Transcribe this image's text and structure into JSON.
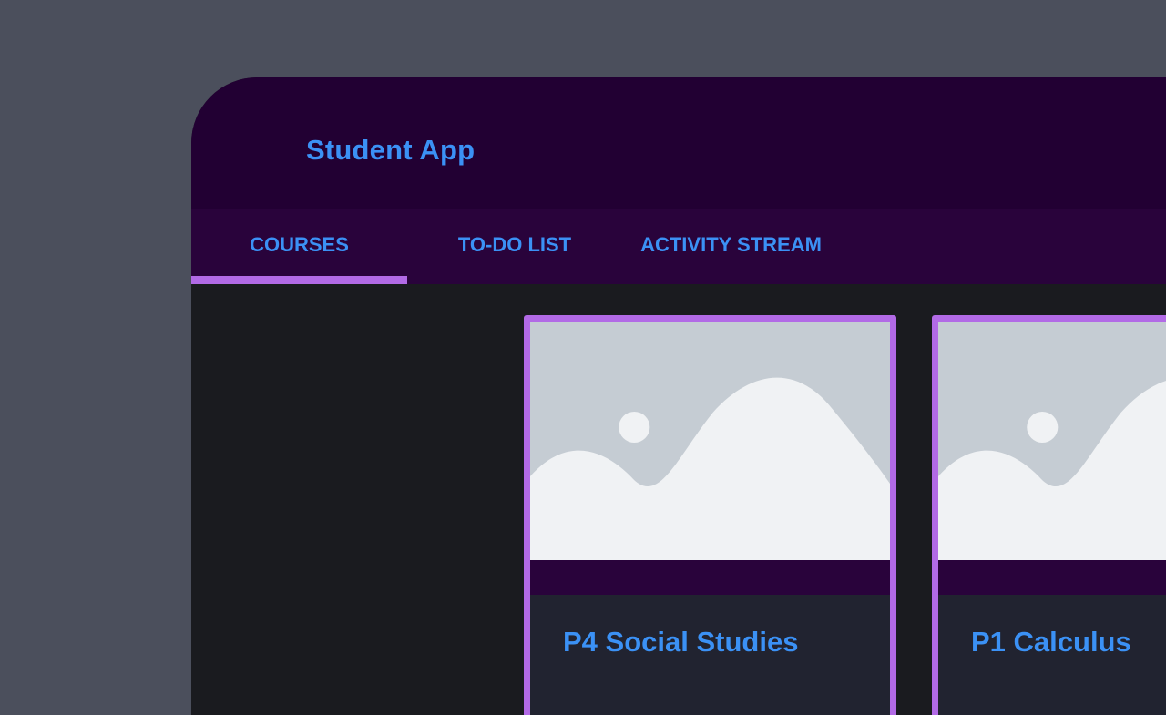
{
  "app": {
    "title": "Student App"
  },
  "tabs": [
    {
      "label": "COURSES",
      "active": true
    },
    {
      "label": "TO-DO LIST",
      "active": false
    },
    {
      "label": "ACTIVITY STREAM",
      "active": false
    }
  ],
  "courses": [
    {
      "title": "P4 Social Studies",
      "image_icon": "image-placeholder-icon"
    },
    {
      "title": "P1 Calculus",
      "image_icon": "image-placeholder-icon"
    }
  ],
  "colors": {
    "background": "#4b4f5c",
    "app_bar": "#220033",
    "tab_bar": "#29033b",
    "accent": "#b26ae6",
    "text_accent": "#3b91f5",
    "content_bg": "#1a1b1f",
    "card_body": "#212330",
    "placeholder_bg": "#c5ccd3",
    "placeholder_fg": "#f0f2f4"
  }
}
